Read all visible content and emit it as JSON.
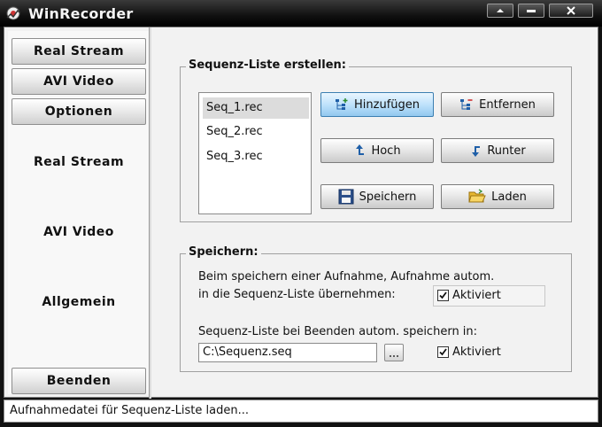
{
  "window": {
    "title": "WinRecorder",
    "icon": "app-logo-icon"
  },
  "titlebar_buttons": [
    "minimize-icon",
    "maximize-icon",
    "close-icon"
  ],
  "sidebar": {
    "buttons": [
      "Real Stream",
      "AVI Video",
      "Optionen"
    ],
    "sections": [
      "Real Stream",
      "AVI Video",
      "Allgemein"
    ],
    "exit_label": "Beenden"
  },
  "sequence": {
    "title": "Sequenz-Liste erstellen:",
    "items": [
      "Seq_1.rec",
      "Seq_2.rec",
      "Seq_3.rec"
    ],
    "selected_index": 0,
    "add_label": "Hinzufügen",
    "remove_label": "Entfernen",
    "up_label": "Hoch",
    "down_label": "Runter",
    "save_label": "Speichern",
    "load_label": "Laden"
  },
  "save_group": {
    "title": "Speichern:",
    "line1": "Beim speichern einer Aufnahme, Aufnahme autom.",
    "line2": "in die Sequenz-Liste übernehmen:",
    "check1_label": "Aktiviert",
    "check1_checked": true,
    "line3": "Sequenz-Liste bei Beenden autom. speichern in:",
    "path_value": "C:\\Sequenz.seq",
    "check2_label": "Aktiviert",
    "check2_checked": true
  },
  "status": {
    "text": "Aufnahmedatei für Sequenz-Liste laden..."
  },
  "colors": {
    "accent": "#92c8ef",
    "titlebar": "#101010"
  }
}
